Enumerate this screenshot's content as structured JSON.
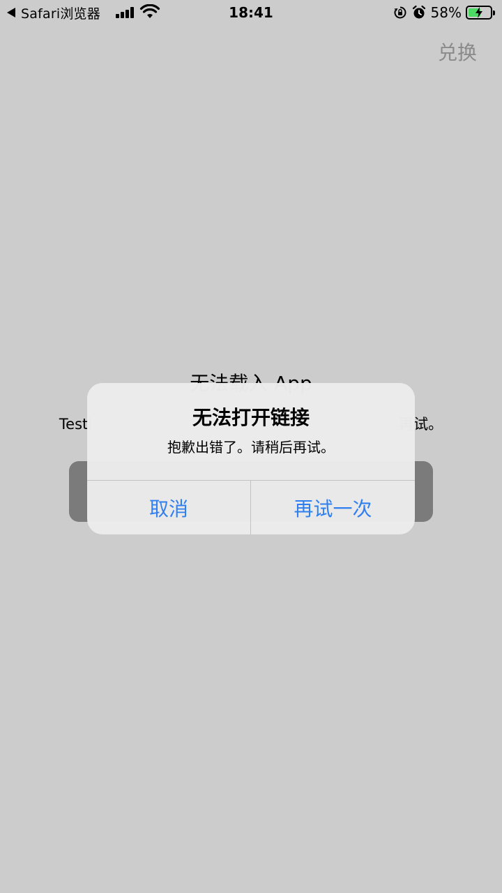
{
  "status_bar": {
    "back_label": "Safari浏览器",
    "time": "18:41",
    "battery_percent": "58%",
    "battery_level": 0.58,
    "icons": [
      "signal-icon",
      "wifi-icon",
      "rotation-lock-icon",
      "alarm-icon",
      "battery-icon"
    ]
  },
  "header": {
    "action_label": "兑换"
  },
  "background": {
    "title": "无法载入 App",
    "message_left": "Testl",
    "message_right": "再试。"
  },
  "alert": {
    "title": "无法打开链接",
    "message": "抱歉出错了。请稍后再试。",
    "cancel_label": "取消",
    "retry_label": "再试一次"
  },
  "colors": {
    "accent": "#2f7ff0",
    "background": "#cccccc",
    "battery_green": "#4cd964"
  }
}
